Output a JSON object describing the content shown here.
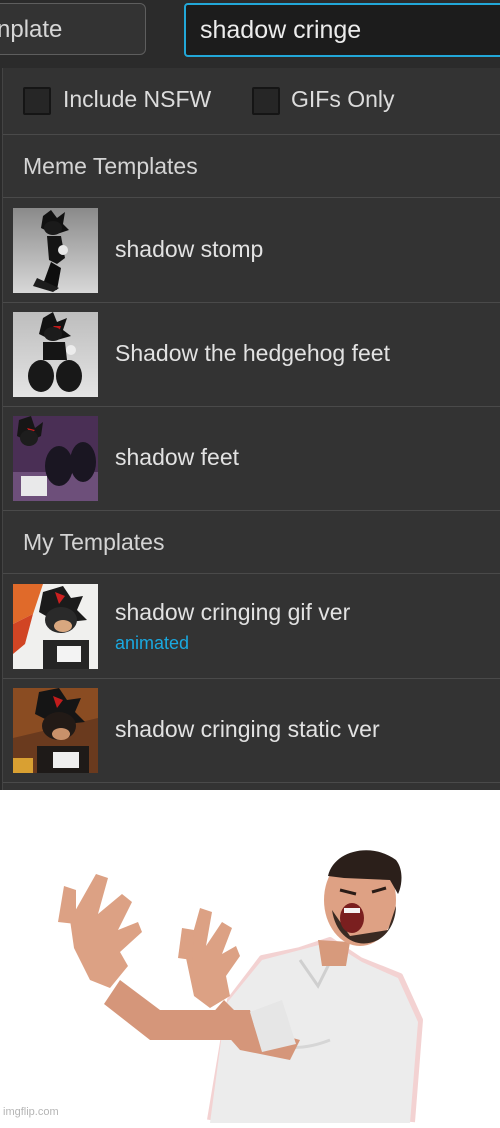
{
  "search": {
    "template_input_text": "nplate",
    "query_value": "shadow cringe"
  },
  "filters": {
    "nsfw_label": "Include NSFW",
    "gifs_label": "GIFs Only"
  },
  "sections": {
    "meme_templates": "Meme Templates",
    "my_templates": "My Templates"
  },
  "meme_templates": [
    {
      "title": "shadow stomp"
    },
    {
      "title": "Shadow the hedgehog feet"
    },
    {
      "title": "shadow feet"
    }
  ],
  "my_templates": [
    {
      "title": "shadow cringing gif ver",
      "badge": "animated"
    },
    {
      "title": "shadow cringing static ver"
    }
  ],
  "watermark": "imgflip.com",
  "colors": {
    "panel_bg": "#2b2b2b",
    "dropdown_bg": "#333333",
    "accent": "#22a7d8",
    "animated_label": "#1aa9e0"
  }
}
